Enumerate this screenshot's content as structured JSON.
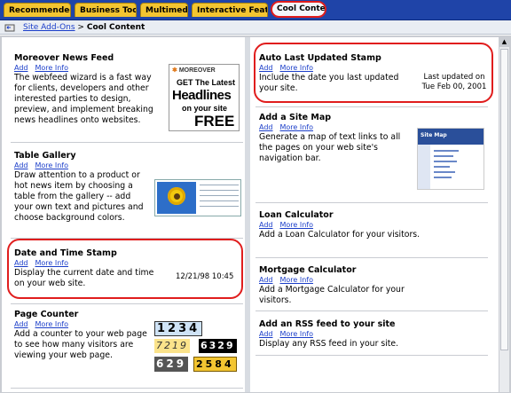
{
  "tabs": [
    {
      "label": "Recommended",
      "active": false
    },
    {
      "label": "Business Tools",
      "active": false
    },
    {
      "label": "Multimedia",
      "active": false
    },
    {
      "label": "Interactive Features",
      "active": false
    },
    {
      "label": "Cool Content",
      "active": true
    }
  ],
  "breadcrumb": {
    "link": "Site Add-Ons",
    "sep": ">",
    "current": "Cool Content"
  },
  "actions": {
    "add": "Add",
    "more": "More Info"
  },
  "left": [
    {
      "title": "Moreover News Feed",
      "desc": "The webfeed wizard is a fast way for clients, developers and other interested parties to design, preview, and implement breaking news headlines onto websites."
    },
    {
      "title": "Table Gallery",
      "desc": "Draw attention to a product or hot news item by choosing a table from the gallery -- add your own text and pictures and choose background colors."
    },
    {
      "title": "Date and Time Stamp",
      "desc": "Display the current date and time on your web site."
    },
    {
      "title": "Page Counter",
      "desc": "Add a counter to your web page to see how many visitors are viewing your web page."
    }
  ],
  "right": [
    {
      "title": "Auto Last Updated Stamp",
      "desc": "Include the date you last updated your site."
    },
    {
      "title": "Add a Site Map",
      "desc": "Generate a map of text links to all the pages on your web site's navigation bar."
    },
    {
      "title": "Loan Calculator",
      "desc": "Add a Loan Calculator for your visitors."
    },
    {
      "title": "Mortgage Calculator",
      "desc": "Add a Mortgage Calculator for your visitors."
    },
    {
      "title": "Add an RSS feed to your site",
      "desc": "Display any RSS feed in your site."
    }
  ],
  "moreover_banner": {
    "brand": "MOREOVER",
    "line1": "GET The Latest",
    "line2": "Headlines",
    "line3": "on your site",
    "line4": "FREE"
  },
  "datetime_sample": "12/21/98  10:45",
  "last_updated_sample": {
    "line1": "Last updated on",
    "line2": "Tue Feb 00, 2001"
  },
  "sitemap_thumb_title": "Site Map",
  "counter_samples": [
    "1234",
    "7219",
    "6329",
    "629",
    "2584"
  ],
  "colors": {
    "tabbar": "#1f44a8",
    "tab": "#f3c531",
    "highlight": "#e01d1d",
    "link": "#1b3ec9"
  }
}
